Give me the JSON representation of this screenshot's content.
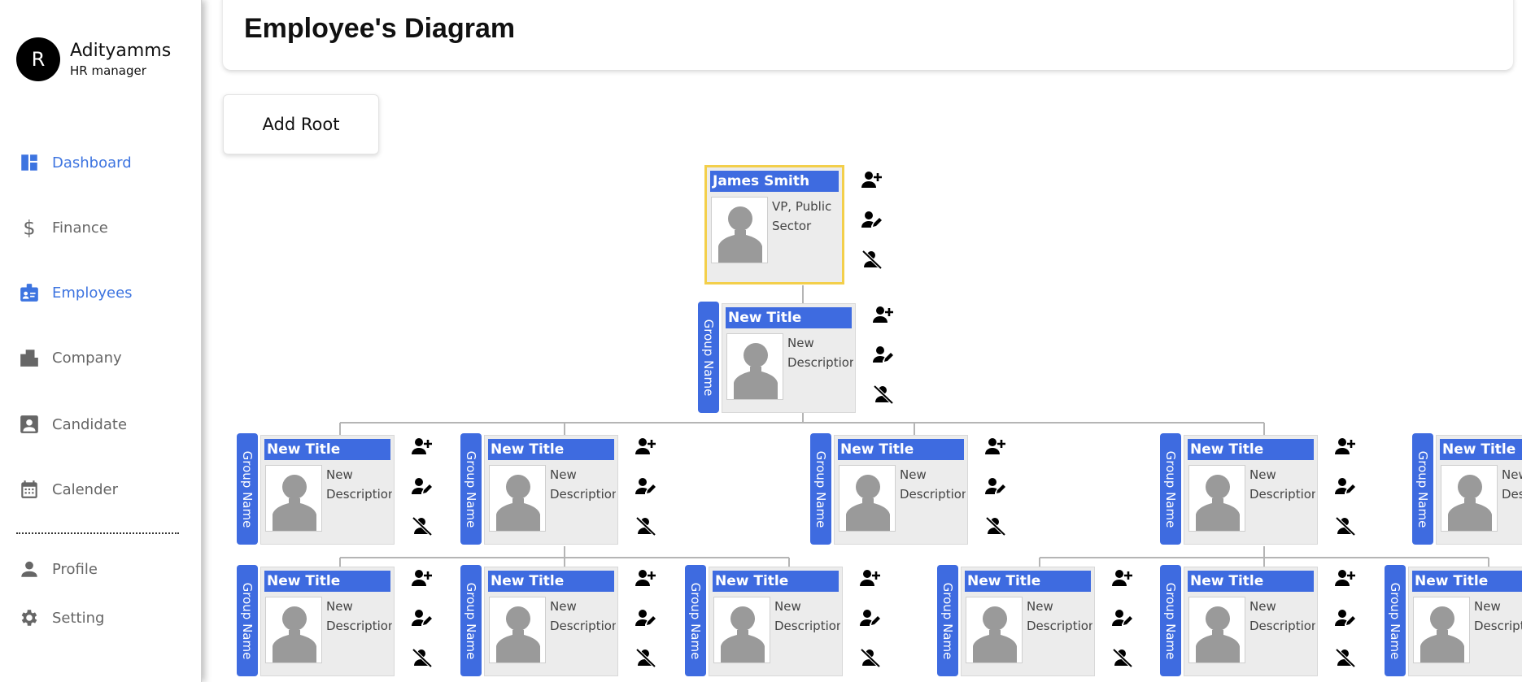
{
  "user": {
    "initial": "R",
    "name": "Adityamms",
    "role": "HR manager"
  },
  "nav": {
    "dashboard": "Dashboard",
    "finance": "Finance",
    "employees": "Employees",
    "company": "Company",
    "candidate": "Candidate",
    "calender": "Calender",
    "profile": "Profile",
    "setting": "Setting"
  },
  "page": {
    "title": "Employee's Diagram",
    "add_root": "Add Root"
  },
  "colors": {
    "accent": "#3e6be0",
    "active_nav": "#3d74e0",
    "root_border": "#f3cf4b",
    "card_bg": "#ececec"
  },
  "icons": {
    "add": "person-add-icon",
    "edit": "person-edit-icon",
    "remove": "person-remove-icon"
  },
  "root": {
    "title": "James Smith",
    "description": "VP, Public Sector"
  },
  "default_node": {
    "title": "New Title",
    "description": "New Description",
    "group": "Group Name"
  }
}
